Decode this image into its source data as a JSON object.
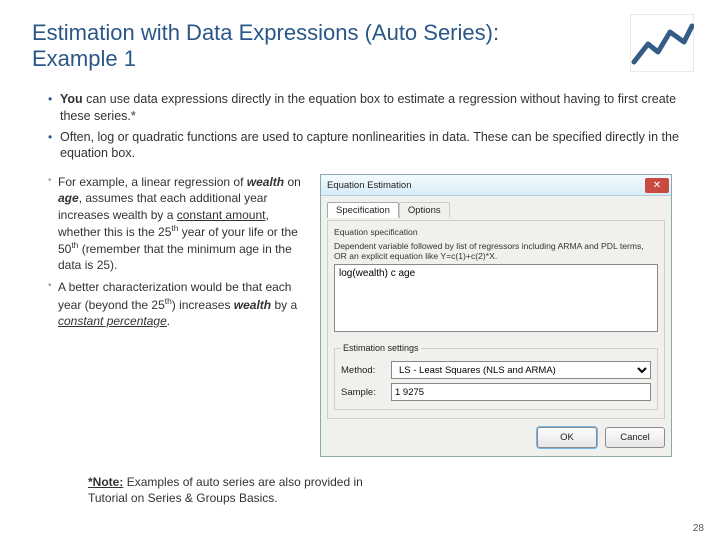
{
  "title": "Estimation with Data Expressions (Auto Series): Example 1",
  "bullets_top": [
    "__BOLD_YOU__ can use data expressions directly in the equation box to estimate a regression without having to first create these series.*",
    "Often, log or quadratic functions are used to capture nonlinearities in data. These can be specified directly in the equation box."
  ],
  "bullets_left_html": [
    "For example, a linear regression of <b><i>wealth</i></b> on <b><i>age</i></b>, assumes that each additional year increases wealth by a <span class=\"u\">constant amount</span>, whether this is the 25<sup>th</sup> year of your life or the 50<sup>th</sup> (remember that the minimum age in the data is 25).",
    "A better characterization would be that each year (beyond the 25<sup>th</sup>) increases <b><i>wealth</i></b> by a <span class=\"u\"><i>constant percentage</i></span>."
  ],
  "note_label": "*Note:",
  "note_text": "Examples of auto series are also provided in Tutorial on Series & Groups Basics.",
  "page_number": "28",
  "dialog": {
    "title": "Equation Estimation",
    "tabs": [
      "Specification",
      "Options"
    ],
    "hint1": "Equation specification",
    "hint2": "Dependent variable followed by list of regressors including ARMA and PDL terms, OR an explicit equation like Y=c(1)+c(2)*X.",
    "equation_value": "log(wealth) c age",
    "est_legend": "Estimation settings",
    "method_label": "Method:",
    "method_value": "LS - Least Squares (NLS and ARMA)",
    "sample_label": "Sample:",
    "sample_value": "1 9275",
    "ok": "OK",
    "cancel": "Cancel"
  }
}
